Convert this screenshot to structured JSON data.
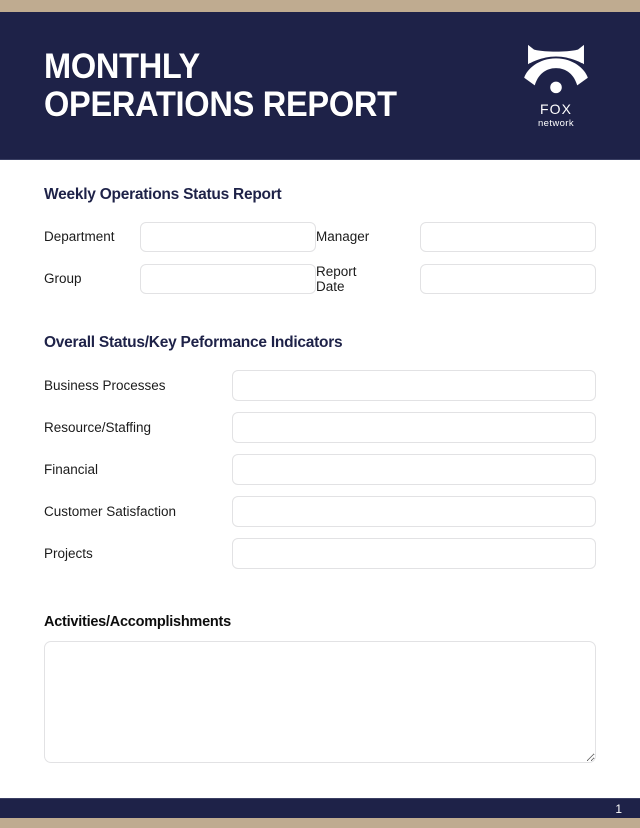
{
  "document": {
    "title_line_1": "MONTHLY",
    "title_line_2": "OPERATIONS REPORT",
    "title_full": "MONTHLY\nOPERATIONS REPORT"
  },
  "brand": {
    "logo_icon": "fox-head-icon",
    "name": "FOX",
    "tagline": "network"
  },
  "colors": {
    "navy": "#1e2248",
    "tan": "#bfab90",
    "field_border": "#e2e2e4",
    "heading_navy": "#1e2248",
    "heading_black": "#0d0d0d",
    "white": "#ffffff"
  },
  "sections": {
    "meta": {
      "heading": "Weekly Operations Status Report",
      "fields": [
        {
          "label": "Department",
          "value": "",
          "placeholder": ""
        },
        {
          "label": "Manager",
          "value": "",
          "placeholder": ""
        },
        {
          "label": "Group",
          "value": "",
          "placeholder": ""
        },
        {
          "label": "Report\nDate",
          "value": "",
          "placeholder": ""
        }
      ]
    },
    "kpi": {
      "heading": "Overall Status/Key Peformance Indicators",
      "rows": [
        {
          "label": "Business Processes",
          "value": "",
          "placeholder": ""
        },
        {
          "label": "Resource/Staffing",
          "value": "",
          "placeholder": ""
        },
        {
          "label": "Financial",
          "value": "",
          "placeholder": ""
        },
        {
          "label": "Customer Satisfaction",
          "value": "",
          "placeholder": ""
        },
        {
          "label": "Projects",
          "value": "",
          "placeholder": ""
        }
      ]
    },
    "activities": {
      "heading": "Activities/Accomplishments",
      "value": "",
      "placeholder": ""
    }
  },
  "footer": {
    "page_number": "1"
  }
}
